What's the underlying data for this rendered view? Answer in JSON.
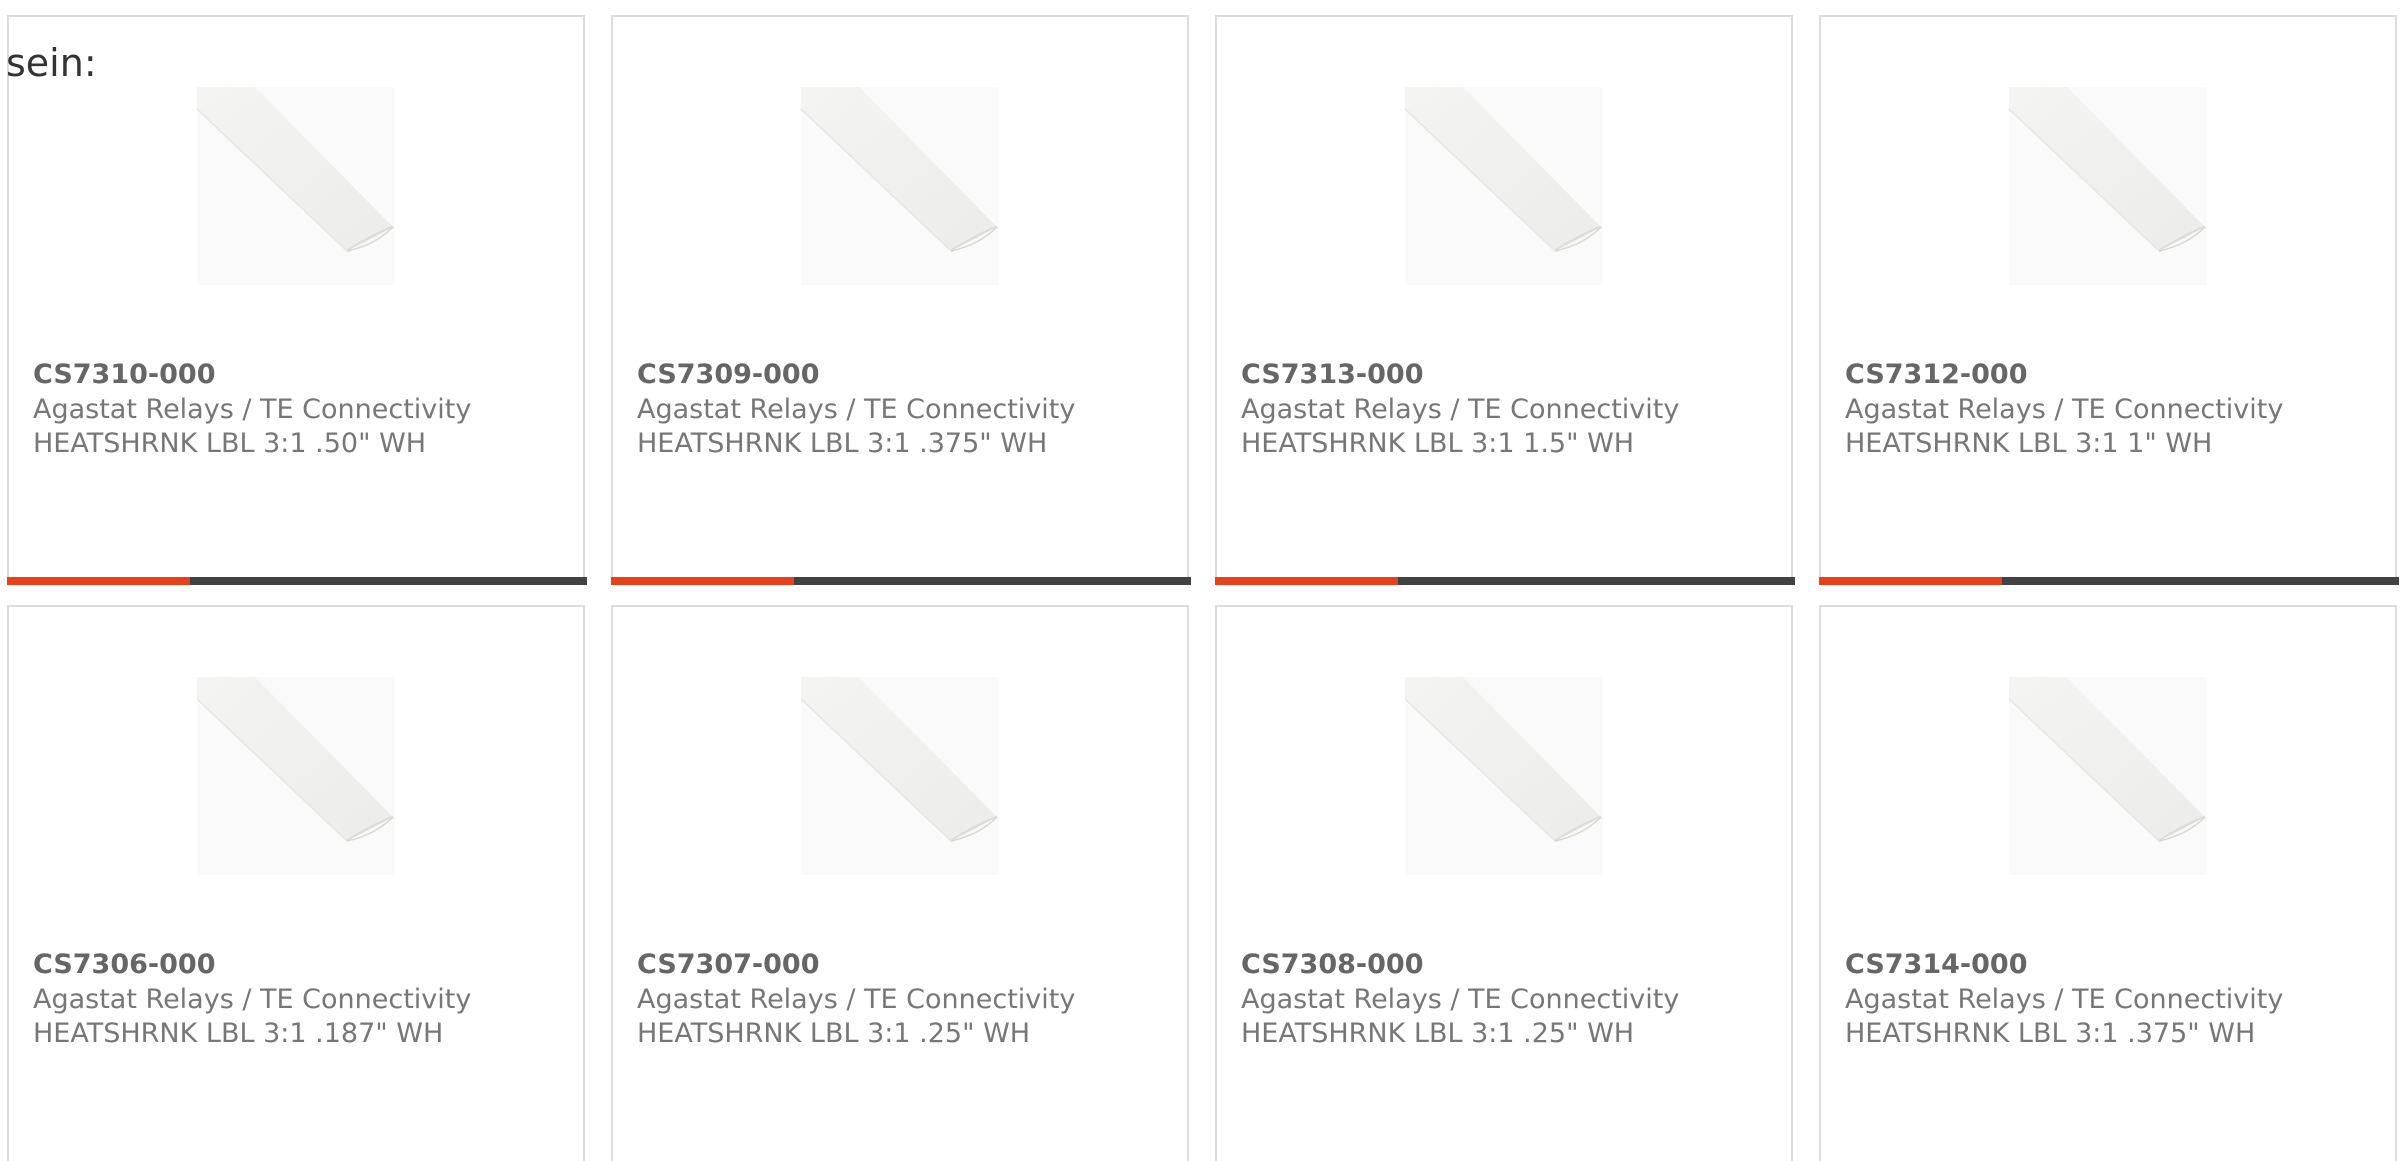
{
  "lead_text": "sein:",
  "accent_color": "#e8411a",
  "bar_color": "#424242",
  "image_icon": "heat-shrink-tube-image",
  "cards": [
    {
      "part_no": "CS7310-000",
      "manufacturer": "Agastat Relays / TE Connectivity",
      "description": "HEATSHRNK LBL 3:1 .50\" WH"
    },
    {
      "part_no": "CS7309-000",
      "manufacturer": "Agastat Relays / TE Connectivity",
      "description": "HEATSHRNK LBL 3:1 .375\" WH"
    },
    {
      "part_no": "CS7313-000",
      "manufacturer": "Agastat Relays / TE Connectivity",
      "description": "HEATSHRNK LBL 3:1 1.5\" WH"
    },
    {
      "part_no": "CS7312-000",
      "manufacturer": "Agastat Relays / TE Connectivity",
      "description": "HEATSHRNK LBL 3:1 1\" WH"
    },
    {
      "part_no": "CS7306-000",
      "manufacturer": "Agastat Relays / TE Connectivity",
      "description": "HEATSHRNK LBL 3:1 .187\" WH"
    },
    {
      "part_no": "CS7307-000",
      "manufacturer": "Agastat Relays / TE Connectivity",
      "description": "HEATSHRNK LBL 3:1 .25\" WH"
    },
    {
      "part_no": "CS7308-000",
      "manufacturer": "Agastat Relays / TE Connectivity",
      "description": "HEATSHRNK LBL 3:1 .25\" WH"
    },
    {
      "part_no": "CS7314-000",
      "manufacturer": "Agastat Relays / TE Connectivity",
      "description": "HEATSHRNK LBL 3:1 .375\" WH"
    }
  ]
}
